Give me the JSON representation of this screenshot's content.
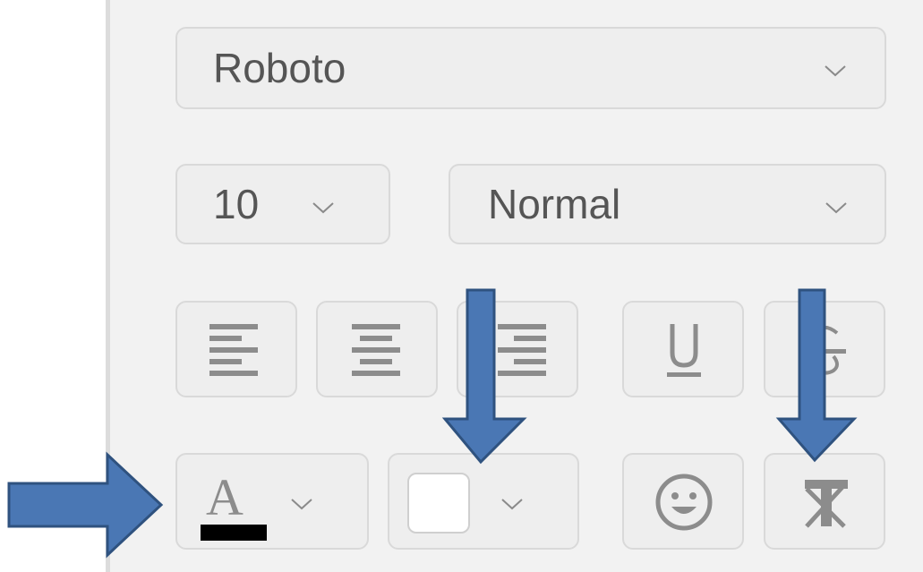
{
  "font_select": {
    "value": "Roboto",
    "icon": "chevron-down-icon"
  },
  "size_select": {
    "value": "10",
    "icon": "chevron-down-icon"
  },
  "style_select": {
    "value": "Normal",
    "icon": "chevron-down-icon"
  },
  "align_buttons": [
    "align-left-icon",
    "align-center-icon",
    "align-right-icon"
  ],
  "format_buttons": [
    "underline-icon",
    "strikethrough-icon"
  ],
  "text_color": {
    "glyph": "A",
    "swatch_color": "#000000"
  },
  "highlight_color": {
    "swatch_color": "#ffffff"
  },
  "emoji_button": {
    "icon": "emoji-icon"
  },
  "clear_format_button": {
    "icon": "clear-format-icon"
  },
  "annotation_arrow_color": "#4a77b4"
}
